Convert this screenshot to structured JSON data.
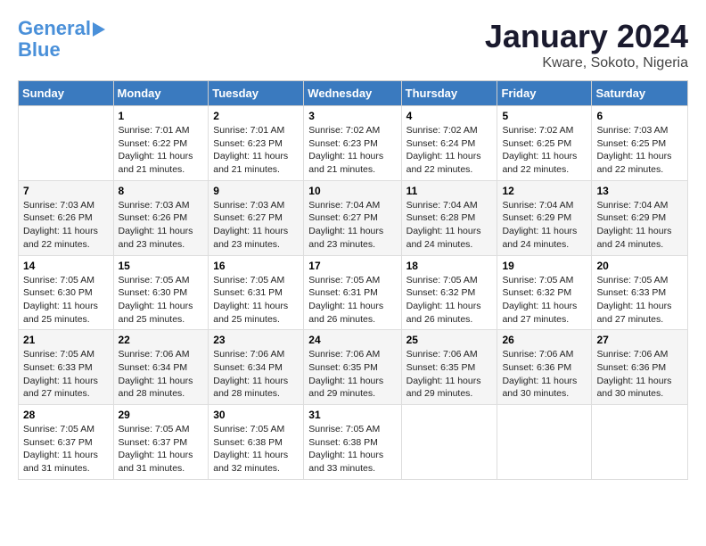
{
  "header": {
    "logo_line1": "General",
    "logo_line2": "Blue",
    "month": "January 2024",
    "location": "Kware, Sokoto, Nigeria"
  },
  "columns": [
    "Sunday",
    "Monday",
    "Tuesday",
    "Wednesday",
    "Thursday",
    "Friday",
    "Saturday"
  ],
  "weeks": [
    [
      {
        "day": "",
        "info": ""
      },
      {
        "day": "1",
        "info": "Sunrise: 7:01 AM\nSunset: 6:22 PM\nDaylight: 11 hours\nand 21 minutes."
      },
      {
        "day": "2",
        "info": "Sunrise: 7:01 AM\nSunset: 6:23 PM\nDaylight: 11 hours\nand 21 minutes."
      },
      {
        "day": "3",
        "info": "Sunrise: 7:02 AM\nSunset: 6:23 PM\nDaylight: 11 hours\nand 21 minutes."
      },
      {
        "day": "4",
        "info": "Sunrise: 7:02 AM\nSunset: 6:24 PM\nDaylight: 11 hours\nand 22 minutes."
      },
      {
        "day": "5",
        "info": "Sunrise: 7:02 AM\nSunset: 6:25 PM\nDaylight: 11 hours\nand 22 minutes."
      },
      {
        "day": "6",
        "info": "Sunrise: 7:03 AM\nSunset: 6:25 PM\nDaylight: 11 hours\nand 22 minutes."
      }
    ],
    [
      {
        "day": "7",
        "info": "Sunrise: 7:03 AM\nSunset: 6:26 PM\nDaylight: 11 hours\nand 22 minutes."
      },
      {
        "day": "8",
        "info": "Sunrise: 7:03 AM\nSunset: 6:26 PM\nDaylight: 11 hours\nand 23 minutes."
      },
      {
        "day": "9",
        "info": "Sunrise: 7:03 AM\nSunset: 6:27 PM\nDaylight: 11 hours\nand 23 minutes."
      },
      {
        "day": "10",
        "info": "Sunrise: 7:04 AM\nSunset: 6:27 PM\nDaylight: 11 hours\nand 23 minutes."
      },
      {
        "day": "11",
        "info": "Sunrise: 7:04 AM\nSunset: 6:28 PM\nDaylight: 11 hours\nand 24 minutes."
      },
      {
        "day": "12",
        "info": "Sunrise: 7:04 AM\nSunset: 6:29 PM\nDaylight: 11 hours\nand 24 minutes."
      },
      {
        "day": "13",
        "info": "Sunrise: 7:04 AM\nSunset: 6:29 PM\nDaylight: 11 hours\nand 24 minutes."
      }
    ],
    [
      {
        "day": "14",
        "info": "Sunrise: 7:05 AM\nSunset: 6:30 PM\nDaylight: 11 hours\nand 25 minutes."
      },
      {
        "day": "15",
        "info": "Sunrise: 7:05 AM\nSunset: 6:30 PM\nDaylight: 11 hours\nand 25 minutes."
      },
      {
        "day": "16",
        "info": "Sunrise: 7:05 AM\nSunset: 6:31 PM\nDaylight: 11 hours\nand 25 minutes."
      },
      {
        "day": "17",
        "info": "Sunrise: 7:05 AM\nSunset: 6:31 PM\nDaylight: 11 hours\nand 26 minutes."
      },
      {
        "day": "18",
        "info": "Sunrise: 7:05 AM\nSunset: 6:32 PM\nDaylight: 11 hours\nand 26 minutes."
      },
      {
        "day": "19",
        "info": "Sunrise: 7:05 AM\nSunset: 6:32 PM\nDaylight: 11 hours\nand 27 minutes."
      },
      {
        "day": "20",
        "info": "Sunrise: 7:05 AM\nSunset: 6:33 PM\nDaylight: 11 hours\nand 27 minutes."
      }
    ],
    [
      {
        "day": "21",
        "info": "Sunrise: 7:05 AM\nSunset: 6:33 PM\nDaylight: 11 hours\nand 27 minutes."
      },
      {
        "day": "22",
        "info": "Sunrise: 7:06 AM\nSunset: 6:34 PM\nDaylight: 11 hours\nand 28 minutes."
      },
      {
        "day": "23",
        "info": "Sunrise: 7:06 AM\nSunset: 6:34 PM\nDaylight: 11 hours\nand 28 minutes."
      },
      {
        "day": "24",
        "info": "Sunrise: 7:06 AM\nSunset: 6:35 PM\nDaylight: 11 hours\nand 29 minutes."
      },
      {
        "day": "25",
        "info": "Sunrise: 7:06 AM\nSunset: 6:35 PM\nDaylight: 11 hours\nand 29 minutes."
      },
      {
        "day": "26",
        "info": "Sunrise: 7:06 AM\nSunset: 6:36 PM\nDaylight: 11 hours\nand 30 minutes."
      },
      {
        "day": "27",
        "info": "Sunrise: 7:06 AM\nSunset: 6:36 PM\nDaylight: 11 hours\nand 30 minutes."
      }
    ],
    [
      {
        "day": "28",
        "info": "Sunrise: 7:05 AM\nSunset: 6:37 PM\nDaylight: 11 hours\nand 31 minutes."
      },
      {
        "day": "29",
        "info": "Sunrise: 7:05 AM\nSunset: 6:37 PM\nDaylight: 11 hours\nand 31 minutes."
      },
      {
        "day": "30",
        "info": "Sunrise: 7:05 AM\nSunset: 6:38 PM\nDaylight: 11 hours\nand 32 minutes."
      },
      {
        "day": "31",
        "info": "Sunrise: 7:05 AM\nSunset: 6:38 PM\nDaylight: 11 hours\nand 33 minutes."
      },
      {
        "day": "",
        "info": ""
      },
      {
        "day": "",
        "info": ""
      },
      {
        "day": "",
        "info": ""
      }
    ]
  ]
}
